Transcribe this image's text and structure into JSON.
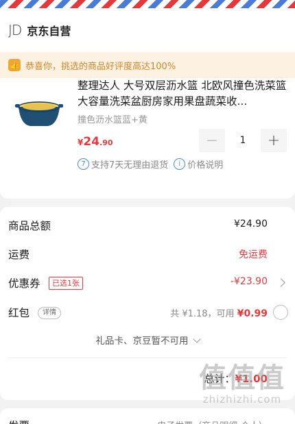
{
  "shop": {
    "logo": "JD",
    "name": "京东自营"
  },
  "notice": {
    "text": "恭喜你，挑选的商品好评度高达100%"
  },
  "product": {
    "title": "整理达人 大号双层沥水篮 北欧风撞色洗菜篮 大容量洗菜盆厨房家用果盘蔬菜收...",
    "spec": "撞色沥水篮蓝+黄",
    "price_symbol": "¥",
    "price_int": "24",
    "price_dec": ".90",
    "quantity": "1",
    "minus": "−",
    "plus": "+",
    "service_1_icon": "7",
    "service_1": "支持7天无理由退货",
    "service_2_icon": "i",
    "service_2": "价格说明"
  },
  "summary": {
    "goods_total_label": "商品总额",
    "goods_total_value": "¥24.90",
    "shipping_label": "运费",
    "shipping_value": "免运费",
    "coupon_label": "优惠券",
    "coupon_tag": "已选1张",
    "coupon_value": "-¥23.90",
    "redpack_label": "红包",
    "redpack_tag": "详情",
    "redpack_info": "共 ¥1.18，可用",
    "redpack_available": "¥0.99",
    "gift_text": "礼品卡、京豆暂不可用",
    "total_label": "总计：",
    "total_value": "¥1.00"
  },
  "invoice": {
    "label": "发票",
    "value": "电子发票（商品明细-个人）"
  },
  "watermark": {
    "big": "值值值",
    "small": "zhizhizhi.com"
  },
  "colors": {
    "accent": "#e4393c",
    "notice_bg": "#fdf2e1",
    "notice_text": "#d2852a",
    "service_blue": "#4a88d8"
  }
}
